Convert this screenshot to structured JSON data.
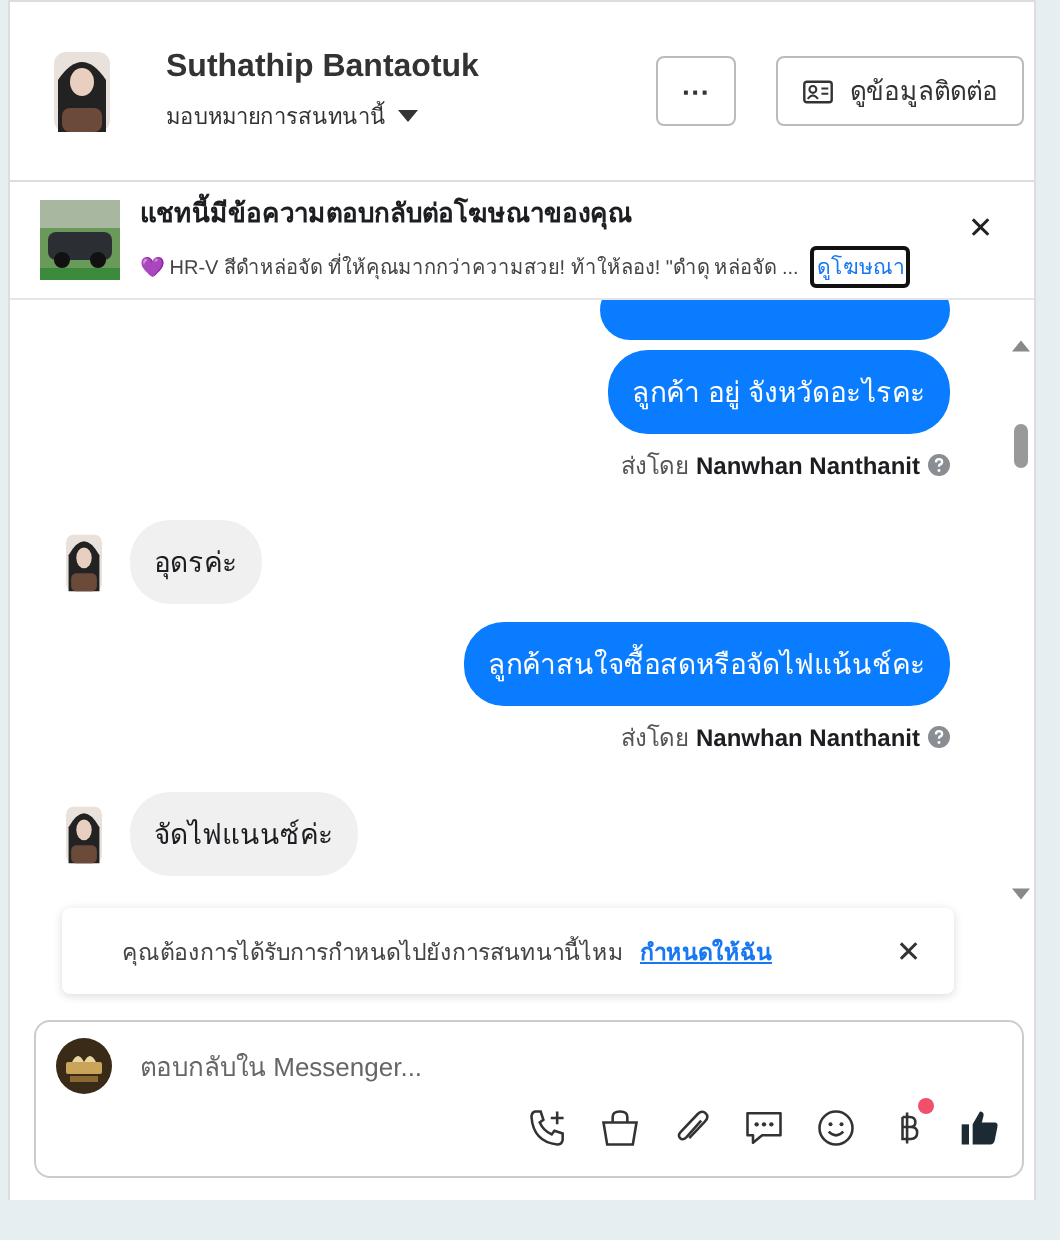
{
  "header": {
    "name": "Suthathip Bantaotuk",
    "assign_label": "มอบหมายการสนทนานี้",
    "more_button": "···",
    "contact_button": "ดูข้อมูลติดต่อ"
  },
  "ad_notice": {
    "title": "แชทนี้มีข้อความตอบกลับต่อโฆษณาของคุณ",
    "snippet": "💜 HR-V สีดำหล่อจัด ที่ให้คุณมากกว่าความสวย! ท้าให้ลอง! \"ดำดุ หล่อจัด ...",
    "link": "ดูโฆษณา",
    "close": "✕"
  },
  "messages": [
    {
      "kind": "outgoing",
      "text": "ลูกค้า  อยู่ จังหวัดอะไรคะ"
    },
    {
      "kind": "sent_by",
      "prefix": "ส่งโดย",
      "sender": "Nanwhan Nanthanit"
    },
    {
      "kind": "incoming",
      "text": "อุดรค่ะ"
    },
    {
      "kind": "outgoing",
      "text": "ลูกค้าสนใจซื้อสดหรือจัดไฟแน้นช์คะ"
    },
    {
      "kind": "sent_by",
      "prefix": "ส่งโดย",
      "sender": "Nanwhan Nanthanit"
    },
    {
      "kind": "incoming",
      "text": "จัดไฟแนนซ์ค่ะ"
    }
  ],
  "assign_prompt": {
    "text": "คุณต้องการได้รับการกำหนดไปยังการสนทนานี้ไหม",
    "link": "กำหนดให้ฉัน",
    "close": "✕"
  },
  "composer": {
    "placeholder": "ตอบกลับใน Messenger...",
    "payment_badge": true
  }
}
